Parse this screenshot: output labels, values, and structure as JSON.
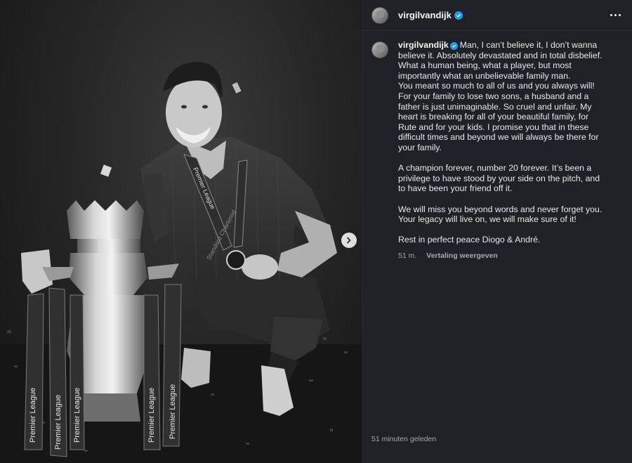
{
  "post": {
    "username": "virgilvandijk",
    "caption": {
      "first_line": "Man, I can’t believe it, I don’t wanna believe it. Absolutely devastated and in total disbelief.",
      "lines": [
        "What a human being, what a player, but most importantly what an unbelievable family man.",
        "You meant so much to all of us and you always will! For your family to lose two sons, a husband and a father is just unimaginable. So cruel and unfair. My heart is breaking for all of your beautiful family, for Rute and for your kids. I promise you that in these difficult times and beyond we will always be there for your family."
      ],
      "paragraph_2": "A champion forever, number 20 forever. It’s been a privilege to have stood by your side on the pitch, and to have been your friend off it.",
      "paragraph_3": "We will miss you beyond words and never forget you. Your legacy will live on, we will make sure of it!",
      "paragraph_4": "Rest in perfect peace Diogo & André."
    },
    "comment_age": "51 m.",
    "translate_label": "Vertaling weergeven",
    "posted_ago": "51 minuten geleden"
  },
  "photo": {
    "trophy_ribbon_text": "Premier League",
    "sash_text": "Premier League",
    "sponsor_text": "Standard Chartered"
  },
  "colors": {
    "panel_bg": "#202126",
    "verified_badge": "#1d9bf0",
    "muted_text": "#a8a8a8"
  }
}
